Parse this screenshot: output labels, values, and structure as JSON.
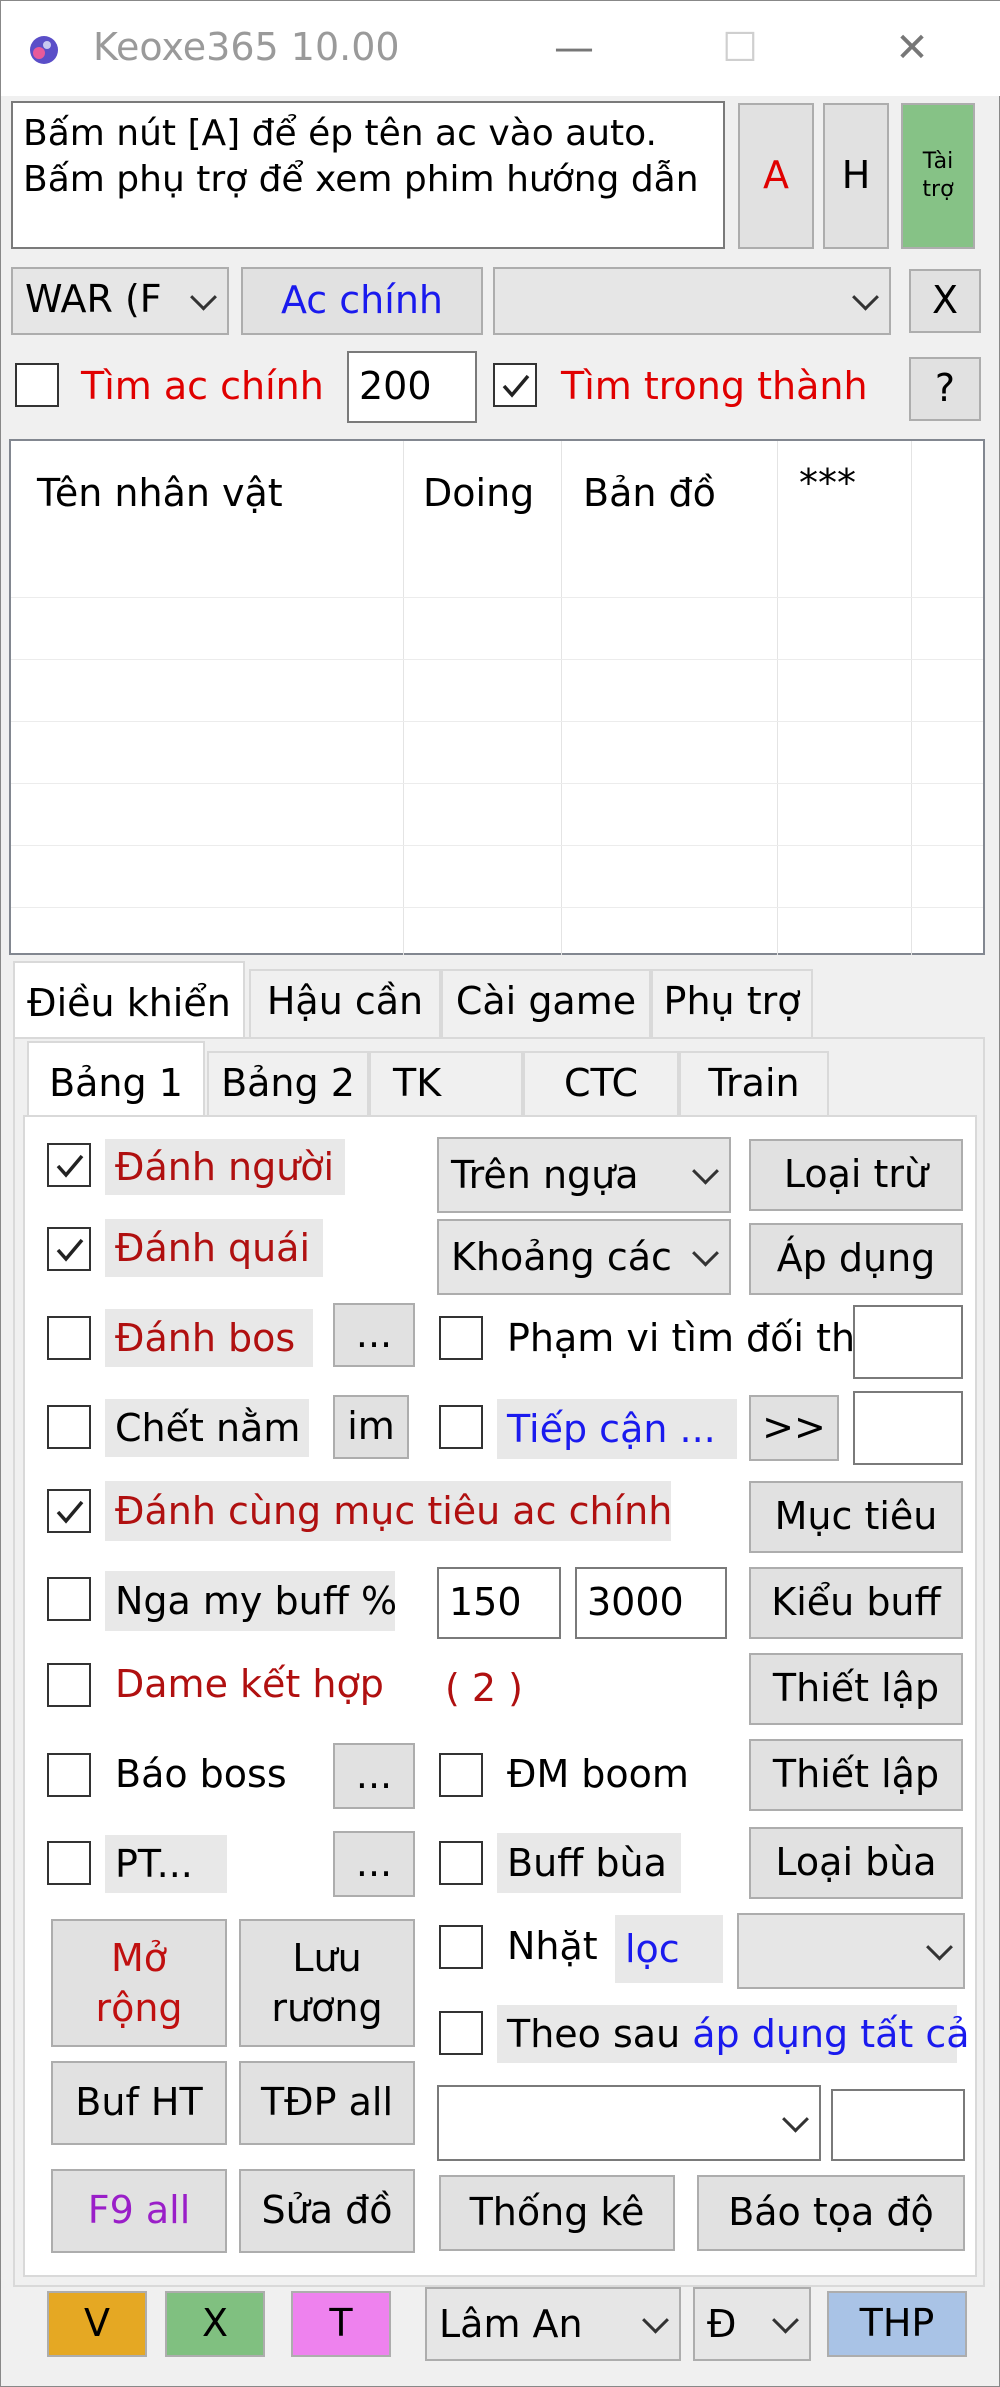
{
  "window": {
    "title": "Keoxe365 10.00",
    "minimize_glyph": "—",
    "maximize_glyph": "☐",
    "close_glyph": "✕"
  },
  "top": {
    "info_line1": "Bấm nút [A] để ép tên ac vào auto.",
    "info_line2": "Bấm phụ trợ để xem phim hướng dẫn",
    "btn_a": "A",
    "btn_h": "H",
    "btn_taitro_line1": "Tài",
    "btn_taitro_line2": "trợ"
  },
  "row2": {
    "war_combo": "WAR (F",
    "ac_chinh_btn": "Ac chính",
    "combo_empty": "",
    "x_btn": "X"
  },
  "row3": {
    "tim_ac_chinh": "Tìm ac chính",
    "tim_ac_chinh_checked": false,
    "range_value": "200",
    "tim_trong_thanh": "Tìm trong thành",
    "tim_trong_thanh_checked": true,
    "help_btn": "?"
  },
  "list": {
    "columns": [
      "Tên nhân vật",
      "Doing",
      "Bản đồ",
      "***"
    ],
    "rows": []
  },
  "main_tabs": [
    "Điều khiển",
    "Hậu cần",
    "Cài game",
    "Phụ trợ"
  ],
  "sub_tabs": [
    "Bảng 1",
    "Bảng 2",
    "TK",
    "CTC",
    "Train"
  ],
  "left": {
    "danh_nguoi": "Đánh người",
    "danh_nguoi_checked": true,
    "danh_quai": "Đánh quái",
    "danh_quai_checked": true,
    "danh_bos": "Đánh bos",
    "danh_bos_checked": false,
    "danh_bos_btn": "...",
    "chet_nam": "Chết nằm",
    "chet_nam_checked": false,
    "chet_nam_btn": "im",
    "danh_cung": "Đánh cùng mục tiêu ac chính",
    "danh_cung_checked": true,
    "nga_my_buff": "Nga my buff %",
    "nga_my_buff_checked": false,
    "dame_ket_hop": "Dame kết hợp",
    "dame_ket_hop_checked": false,
    "dame_count": "( 2 )",
    "bao_boss": "Báo boss",
    "bao_boss_checked": false,
    "bao_boss_btn": "...",
    "pt": "PT...",
    "pt_checked": false,
    "pt_btn": "...",
    "mo_rong_line1": "Mở",
    "mo_rong_line2": "rộng",
    "luu_ruong_line1": "Lưu",
    "luu_ruong_line2": "rương",
    "buf_ht": "Buf HT",
    "tdp_all": "TĐP all",
    "f9_all": "F9 all",
    "sua_do": "Sửa đồ"
  },
  "right": {
    "tren_ngua": "Trên ngựa",
    "loai_tru": "Loại trừ",
    "khoang_cach": "Khoảng các",
    "ap_dung": "Áp dụng",
    "pham_vi": "Phạm vi tìm đối thủ",
    "pham_vi_checked": false,
    "pham_vi_value": "",
    "tiep_can": "Tiếp cận ...",
    "tiep_can_checked": false,
    "tiep_can_btn": ">>",
    "tiep_can_value": "",
    "muc_tieu": "Mục tiêu",
    "buff_value1": "150",
    "buff_value2": "3000",
    "kieu_buff": "Kiểu buff",
    "thiet_lap1": "Thiết lập",
    "dm_boom": "ĐM boom",
    "dm_boom_checked": false,
    "thiet_lap2": "Thiết lập",
    "buff_bua": "Buff bùa",
    "buff_bua_checked": false,
    "loai_bua": "Loại bùa",
    "nhat": "Nhặt",
    "nhat_checked": false,
    "loc": "lọc",
    "nhat_combo": "",
    "theo_sau": "Theo sau",
    "theo_sau_checked": false,
    "ap_dung_tat_ca": "áp dụng tất cả",
    "bottom_combo": "",
    "bottom_value": "",
    "thong_ke": "Thống kê",
    "bao_toa_do": "Báo tọa độ"
  },
  "bottom": {
    "v": "V",
    "x": "X",
    "t": "T",
    "lam_an": "Lâm An",
    "d": "Đ",
    "thp": "THP"
  },
  "colors": {
    "v_btn": "#e5a823",
    "x_btn": "#80c080",
    "t_btn": "#ee82ee",
    "thp_btn": "#a9c3e6",
    "taitro_btn": "#86c286"
  }
}
